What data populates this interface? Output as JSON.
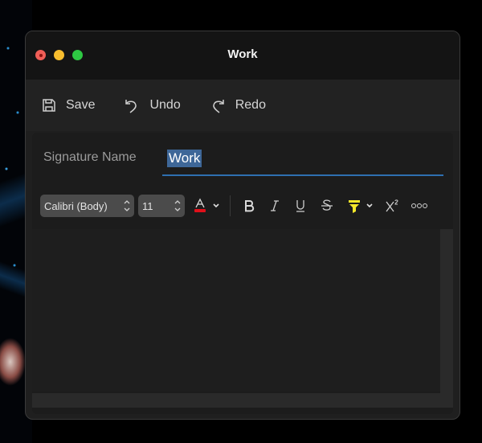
{
  "window": {
    "title": "Work",
    "controls": [
      "close",
      "minimize",
      "zoom"
    ]
  },
  "toolbar": {
    "save_label": "Save",
    "undo_label": "Undo",
    "redo_label": "Redo"
  },
  "signature": {
    "name_label": "Signature Name",
    "name_value": "Work"
  },
  "formatting": {
    "font_value": "Calibri (Body)",
    "size_value": "11",
    "font_color": "#e0101a",
    "highlight_color": "#f5e82a",
    "buttons": [
      "font-color",
      "bold",
      "italic",
      "underline",
      "strikethrough",
      "highlight",
      "superscript",
      "more-options"
    ]
  },
  "colors": {
    "accent": "#2e6fb0",
    "selection": "#3e6798",
    "window_bg": "#1f1f1f",
    "titlebar_bg": "#141414"
  }
}
